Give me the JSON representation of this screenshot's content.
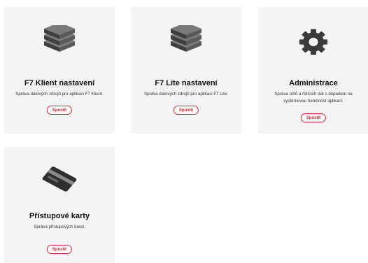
{
  "tiles": [
    {
      "icon": "server-stack-icon",
      "title": "F7 Klient nastavení",
      "description": "Správa datových zdrojů pro aplikaci F7 Klient.",
      "button": "Spustit"
    },
    {
      "icon": "server-stack-icon",
      "title": "F7 Lite nastavení",
      "description": "Správa datových zdrojů pro aplikaci F7 Lite.",
      "button": "Spustit"
    },
    {
      "icon": "gear-icon",
      "title": "Administrace",
      "description": "Správa účtů a řídících dat s dopadem na systémovou funkčnost aplikací.",
      "button": "Spustit"
    },
    {
      "icon": "access-card-icon",
      "title": "Přístupové karty",
      "description": "Správa přístupových karet.",
      "button": "Spustit"
    }
  ],
  "colors": {
    "tile_background": "#f3f4f6",
    "accent": "#d9262c",
    "icon_dark": "#4a4a4a"
  }
}
